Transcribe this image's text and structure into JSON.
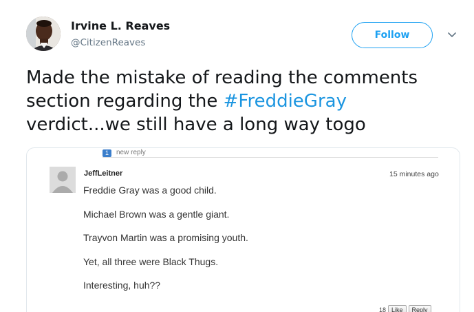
{
  "tweet": {
    "author": {
      "display_name": "Irvine L. Reaves",
      "handle": "@CitizenReaves"
    },
    "follow_label": "Follow",
    "caret_icon": "chevron-down-icon",
    "text_lines": [
      {
        "before": "Made the mistake of reading the comments",
        "hashtag": "",
        "after": ""
      },
      {
        "before": "section regarding the ",
        "hashtag": "#FreddieGray",
        "after": ""
      },
      {
        "before": "verdict...we still have a long way togo",
        "hashtag": "",
        "after": ""
      }
    ],
    "accent_color": "#1da1f2",
    "hashtag_color": "#1b95e0"
  },
  "media": {
    "new_reply_count": "1",
    "new_reply_label": "new reply",
    "comment": {
      "author": "JeffLeitner",
      "time": "15 minutes ago",
      "lines": [
        "Freddie Gray was a good child.",
        "Michael Brown was a gentle giant.",
        "Trayvon Martin was a promising youth.",
        "Yet, all three were Black Thugs.",
        "Interesting, huh??"
      ],
      "like_count": "18",
      "like_label": "Like",
      "reply_label": "Reply"
    }
  }
}
